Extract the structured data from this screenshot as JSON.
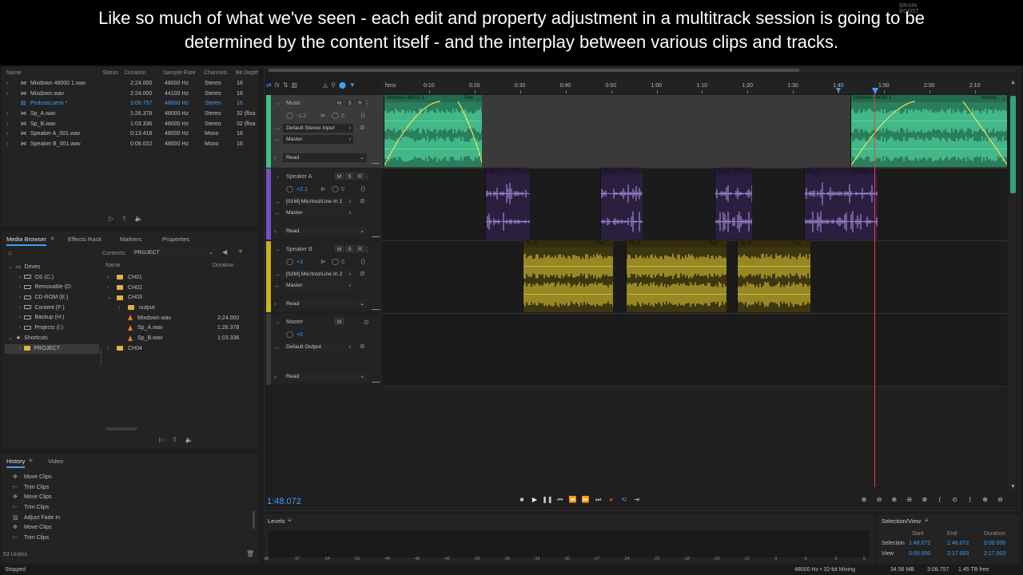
{
  "subtitle": {
    "line1": "Like so much of what we've seen - each edit and property adjustment in a multitrack session is going to be",
    "line2": "determined by the content itself - and the interplay between various clips and tracks."
  },
  "logo": {
    "line1": "BRAIN",
    "line2": "BOOST"
  },
  "files_panel": {
    "columns": [
      "Name",
      "Status",
      "Duration",
      "Sample Rate",
      "Channels",
      "Bit Depth"
    ],
    "rows": [
      {
        "name": "Mixdown 48000 1.wav",
        "duration": "2:24.000",
        "rate": "48000 Hz",
        "channels": "Stereo",
        "bits": "16",
        "active": false
      },
      {
        "name": "Mixdown.wav",
        "duration": "2:24.000",
        "rate": "44100 Hz",
        "channels": "Stereo",
        "bits": "16",
        "active": false
      },
      {
        "name": "Podcast.sesx *",
        "duration": "3:08.757",
        "rate": "48000 Hz",
        "channels": "Stereo",
        "bits": "16",
        "active": true
      },
      {
        "name": "Sp_A.wav",
        "duration": "1:26.378",
        "rate": "48000 Hz",
        "channels": "Stereo",
        "bits": "32 (floa",
        "active": false
      },
      {
        "name": "Sp_B.wav",
        "duration": "1:03.336",
        "rate": "48000 Hz",
        "channels": "Stereo",
        "bits": "32 (floa",
        "active": false
      },
      {
        "name": "Speaker A_001.wav",
        "duration": "0:13.418",
        "rate": "48000 Hz",
        "channels": "Mono",
        "bits": "16",
        "active": false
      },
      {
        "name": "Speaker B_001.wav",
        "duration": "0:08.022",
        "rate": "48000 Hz",
        "channels": "Mono",
        "bits": "16",
        "active": false
      }
    ]
  },
  "media_browser": {
    "tabs": [
      "Media Browser",
      "Effects Rack",
      "Markers",
      "Properties"
    ],
    "contents_label": "Contents:",
    "contents_value": "PROJECT",
    "tree": [
      {
        "label": "Drives",
        "indent": 0
      },
      {
        "label": "OS (C:)",
        "indent": 1
      },
      {
        "label": "Removable (D:",
        "indent": 1
      },
      {
        "label": "CD-ROM (E:)",
        "indent": 1
      },
      {
        "label": "Content (F:)",
        "indent": 1
      },
      {
        "label": "Backup (H:)",
        "indent": 1
      },
      {
        "label": "Projects (I:)",
        "indent": 1
      },
      {
        "label": "Shortcuts",
        "indent": 0
      },
      {
        "label": "PROJECT",
        "indent": 1
      }
    ],
    "list_columns": [
      "Name",
      "Duration"
    ],
    "list": [
      {
        "name": "CH01",
        "type": "folder",
        "duration": "",
        "indent": 0
      },
      {
        "name": "CH02",
        "type": "folder",
        "duration": "",
        "indent": 0
      },
      {
        "name": "CH03",
        "type": "folder",
        "duration": "",
        "indent": 0
      },
      {
        "name": "output",
        "type": "folder",
        "duration": "",
        "indent": 1
      },
      {
        "name": "Mixdown.wav",
        "type": "audio",
        "duration": "2:24.000",
        "indent": 1
      },
      {
        "name": "Sp_A.wav",
        "type": "audio",
        "duration": "1:26.378",
        "indent": 1
      },
      {
        "name": "Sp_B.wav",
        "type": "audio",
        "duration": "1:03.336",
        "indent": 1
      },
      {
        "name": "CH04",
        "type": "folder",
        "duration": "",
        "indent": 0
      }
    ]
  },
  "history": {
    "tabs": [
      "History",
      "Video"
    ],
    "items": [
      "Move Clips",
      "Trim Clips",
      "Move Clips",
      "Trim Clips",
      "Adjust Fade In",
      "Move Clips",
      "Trim Clips"
    ],
    "undo_count": "53 Undos"
  },
  "status": {
    "left": "Stopped",
    "format": "48000 Hz • 32-bit Mixing",
    "memory": "34.56 MB",
    "duration": "3:08.757",
    "free": "1.45 TB free"
  },
  "timeline": {
    "ruler_unit": "hms",
    "ruler_labels": [
      "0:10",
      "0:20",
      "0:30",
      "0:40",
      "0:50",
      "1:00",
      "1:10",
      "1:20",
      "1:30",
      "1:40",
      "1:50",
      "2:00",
      "2:10"
    ],
    "current_time": "1:48.072"
  },
  "tracks": [
    {
      "name": "Music",
      "volume": "-1.2",
      "pan": "0",
      "input": "Default Stereo Input",
      "output": "Master",
      "mode": "Read",
      "color": "#3ac28a"
    },
    {
      "name": "Speaker A",
      "volume": "+2.1",
      "pan": "0",
      "input": "[01M] Mic/Inst/Line In 1",
      "output": "Master",
      "mode": "Read",
      "color": "#7a4fc0"
    },
    {
      "name": "Speaker B",
      "volume": "+3",
      "pan": "0",
      "input": "[02M] Mic/Inst/Line In 2",
      "output": "Master",
      "mode": "Read",
      "color": "#c9b21a"
    },
    {
      "name": "Master",
      "volume": "+0",
      "pan": "",
      "input": "Default Output",
      "output": "",
      "mode": "Read",
      "color": "#888888"
    }
  ],
  "clips": {
    "music": [
      {
        "name": "Mixdown 48000 1",
        "fx": "Pan"
      },
      {
        "name": "Mixdown 48000 1",
        "fx": "Volume"
      }
    ],
    "speaker_a": [
      {
        "name": "Sp_A",
        "fx": "Pan"
      },
      {
        "name": "Sp_A",
        "fx": "Pan"
      },
      {
        "name": "Sp_A",
        "fx": "Pan"
      },
      {
        "name": "Sp_A",
        "fx": "Volume"
      }
    ],
    "speaker_b": [
      {
        "name": "Sp_B",
        "fx": "Pan"
      },
      {
        "name": "Sp_B",
        "fx": "Pan"
      },
      {
        "name": "Sp_B",
        "fx": "Pan"
      }
    ]
  },
  "levels": {
    "title": "Levels",
    "scale": [
      "dB",
      "-57",
      "-54",
      "-51",
      "-48",
      "-45",
      "-42",
      "-39",
      "-36",
      "-33",
      "-30",
      "-27",
      "-24",
      "-21",
      "-18",
      "-15",
      "-12",
      "-9",
      "-6",
      "-3",
      "0"
    ]
  },
  "selection_view": {
    "title": "Selection/View",
    "col_headers": [
      "Start",
      "End",
      "Duration"
    ],
    "rows": [
      {
        "label": "Selection",
        "start": "1:48.072",
        "end": "1:48.072",
        "duration": "0:00.000"
      },
      {
        "label": "View",
        "start": "0:00.000",
        "end": "2:17.003",
        "duration": "2:17.003"
      }
    ]
  },
  "colors": {
    "accent": "#3aa0ff",
    "music": "#3ac28a",
    "speaker_a": "#7a4fc0",
    "speaker_b": "#c9b21a"
  }
}
